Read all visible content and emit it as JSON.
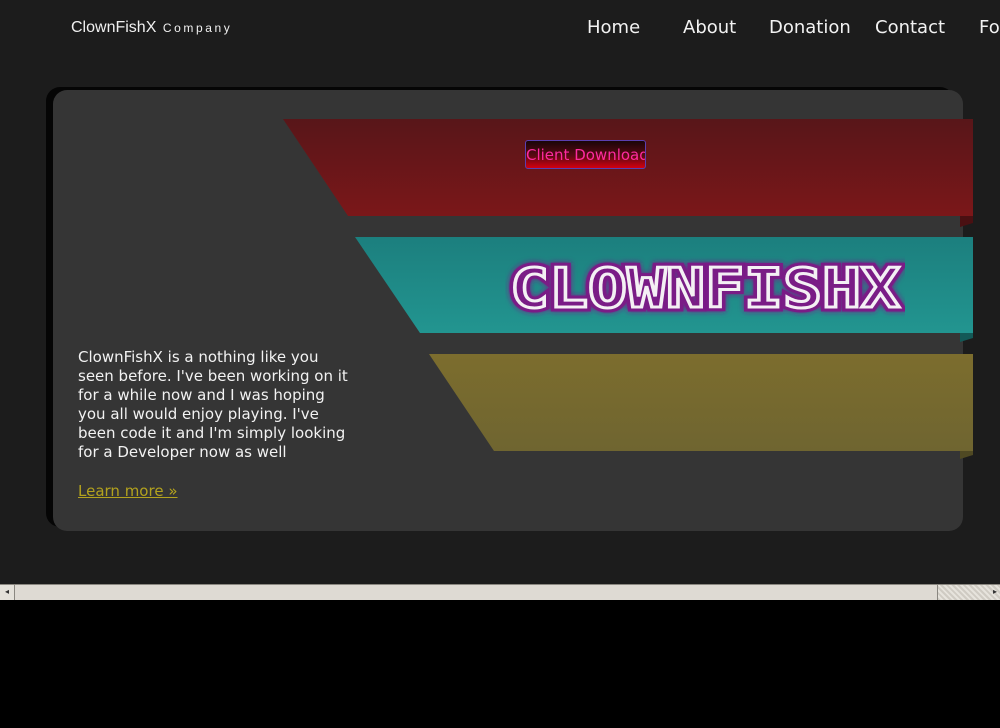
{
  "header": {
    "brand_name": "ClownFishX",
    "brand_sub": "Company"
  },
  "nav": {
    "items": [
      {
        "label": "Home"
      },
      {
        "label": "About"
      },
      {
        "label": "Donation"
      },
      {
        "label": "Contact"
      },
      {
        "label": "Fo"
      }
    ]
  },
  "hero": {
    "download_label": "Client Download",
    "logo_text": "CLOWNFISHX",
    "description": "ClownFishX is a nothing like you seen before. I've been working on it for a while now and I was hoping you all would enjoy playing. I've been code it and I'm simply looking for a Developer now as well",
    "learn_more": "Learn more »",
    "stripe_colors": [
      "#6a1418",
      "#1e8d8a",
      "#746a2e"
    ]
  },
  "scrollbar": {
    "left_arrow": "◂",
    "right_arrow": "▸"
  }
}
